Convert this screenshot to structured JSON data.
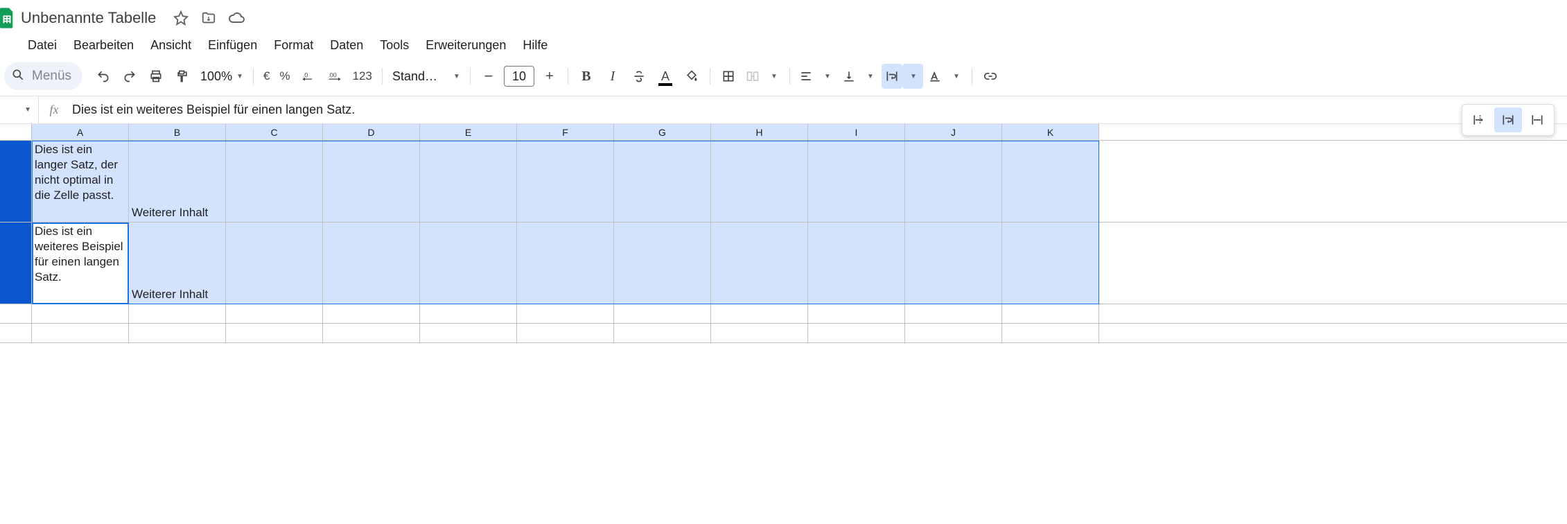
{
  "title": "Unbenannte Tabelle",
  "menus_label": "Menüs",
  "menu": {
    "file": "Datei",
    "edit": "Bearbeiten",
    "view": "Ansicht",
    "insert": "Einfügen",
    "format": "Format",
    "data": "Daten",
    "tools": "Tools",
    "extensions": "Erweiterungen",
    "help": "Hilfe"
  },
  "toolbar": {
    "zoom": "100%",
    "currency": "€",
    "percent": "%",
    "dec_dec": ".0",
    "inc_dec": ".00",
    "num_format": "123",
    "font_name": "Stand…",
    "font_size": "10"
  },
  "formula_bar": {
    "fx": "fx",
    "value": "Dies ist ein weiteres Beispiel für einen langen Satz."
  },
  "columns": [
    "A",
    "B",
    "C",
    "D",
    "E",
    "F",
    "G",
    "H",
    "I",
    "J",
    "K"
  ],
  "cells": {
    "a1": "Dies ist ein langer Satz, der nicht optimal in die Zelle passt.",
    "b1": "Weiterer Inhalt",
    "a2": "Dies ist ein weiteres Beispiel für einen langen Satz.",
    "b2": "Weiterer Inhalt"
  }
}
